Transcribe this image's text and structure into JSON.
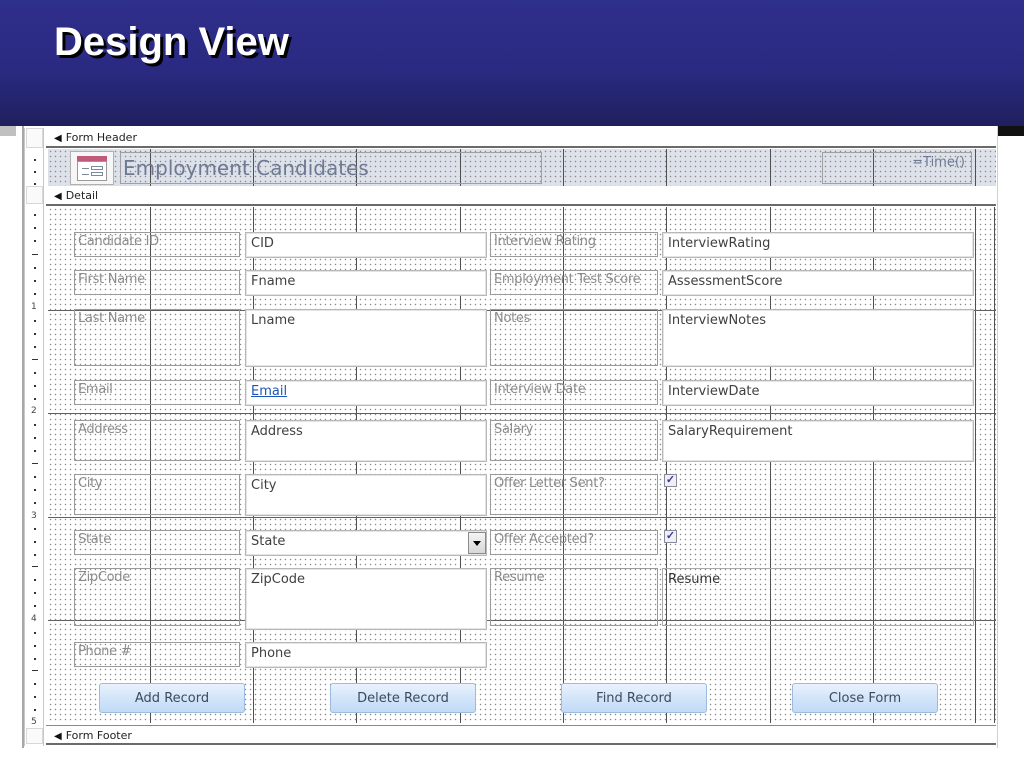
{
  "slide": {
    "title": "Design View"
  },
  "sections": {
    "form_header": "Form Header",
    "detail": "Detail",
    "form_footer": "Form Footer"
  },
  "header": {
    "form_title": "Employment Candidates",
    "time_expression": "=Time()",
    "icon": "form-icon"
  },
  "ruler": {
    "marks": [
      "1",
      "2",
      "3",
      "4",
      "5"
    ]
  },
  "fields": {
    "left": [
      {
        "label": "Candidate ID",
        "control": "CID"
      },
      {
        "label": "First Name",
        "control": "Fname"
      },
      {
        "label": "Last Name",
        "control": "Lname"
      },
      {
        "label": "Email",
        "control": "Email"
      },
      {
        "label": "Address",
        "control": "Address"
      },
      {
        "label": "City",
        "control": "City"
      },
      {
        "label": "State",
        "control": "State"
      },
      {
        "label": "ZipCode",
        "control": "ZipCode"
      },
      {
        "label": "Phone #",
        "control": "Phone"
      }
    ],
    "right": [
      {
        "label": "Interview Rating",
        "control": "InterviewRating"
      },
      {
        "label": "Employment Test Score",
        "control": "AssessmentScore"
      },
      {
        "label": "Notes",
        "control": "InterviewNotes"
      },
      {
        "label": "Interview Date",
        "control": "InterviewDate"
      },
      {
        "label": "Salary",
        "control": "SalaryRequirement"
      },
      {
        "label": "Offer Letter Sent?",
        "checked": true
      },
      {
        "label": "Offer Accepted?",
        "checked": true
      },
      {
        "label": "Resume",
        "control": "Resume"
      }
    ]
  },
  "buttons": {
    "add": "Add Record",
    "delete": "Delete Record",
    "find": "Find Record",
    "close": "Close Form"
  },
  "colors": {
    "banner": "#2a2a82",
    "button_fill": "#d3e5fa",
    "link": "#1a56b8"
  }
}
